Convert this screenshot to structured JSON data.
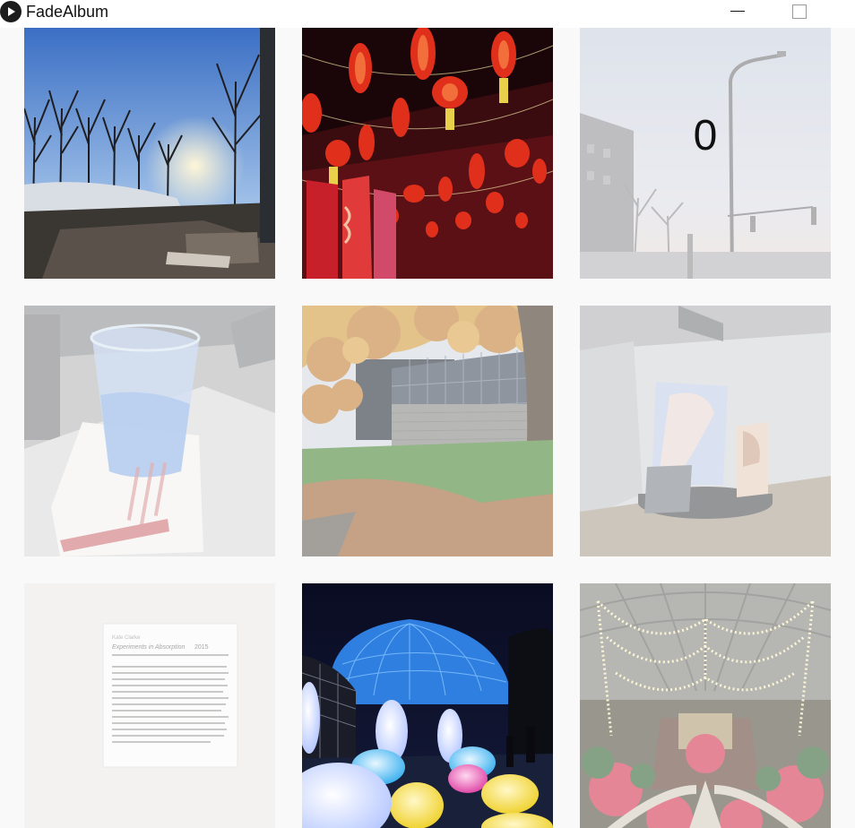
{
  "window": {
    "title": "FadeAlbum"
  },
  "overlay": {
    "counter": "0"
  },
  "photos": [
    {
      "subject": "winter-trees-sunset",
      "opacity": 1.0
    },
    {
      "subject": "red-lanterns",
      "opacity": 1.0
    },
    {
      "subject": "street-lamp-sky",
      "opacity": 0.55
    },
    {
      "subject": "water-cup-on-napkin",
      "opacity": 0.35
    },
    {
      "subject": "autumn-tree-building",
      "opacity": 0.6
    },
    {
      "subject": "gallery-art-installation",
      "opacity": 0.45
    },
    {
      "subject": "museum-wall-label",
      "opacity": 0.5
    },
    {
      "subject": "glowing-egg-lights-conservatory",
      "opacity": 1.0
    },
    {
      "subject": "greenhouse-string-lights",
      "opacity": 0.6
    }
  ],
  "wall_label": {
    "artist": "Kate Clarke",
    "title": "Experiments in Absorption",
    "year": "2015"
  },
  "colors": {
    "titlebar_bg": "#ffffff",
    "window_bg": "#f9f9f9",
    "lantern_red": "#d42a1a",
    "conservatory_blue": "#2f7fe0"
  }
}
